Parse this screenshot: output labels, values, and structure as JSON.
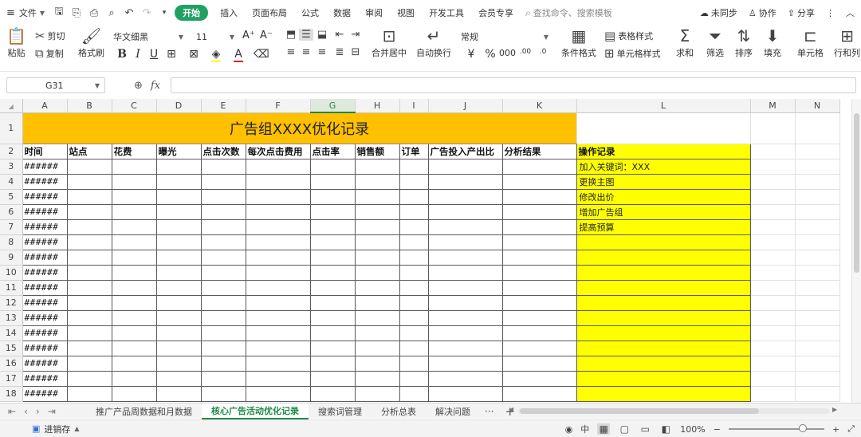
{
  "menubar": {
    "file_label": "文件",
    "items": [
      "开始",
      "插入",
      "页面布局",
      "公式",
      "数据",
      "审阅",
      "视图",
      "开发工具",
      "会员专享"
    ],
    "search_placeholder": "查找命令、搜索模板",
    "right": {
      "sync": "未同步",
      "collab": "协作",
      "share": "分享"
    }
  },
  "ribbon": {
    "paste": "粘贴",
    "cut": "剪切",
    "copy": "复制",
    "format_painter": "格式刷",
    "font_name": "华文细黑",
    "font_size": "11",
    "number_format": "常规",
    "merge_center": "合并居中",
    "wrap_text": "自动换行",
    "conditional_format": "条件格式",
    "table_style": "表格样式",
    "cell_style": "单元格样式",
    "sum": "求和",
    "filter": "筛选",
    "sort": "排序",
    "fill": "填充",
    "cells": "单元格",
    "rows_cols": "行和列"
  },
  "formula_bar": {
    "cell_ref": "G31",
    "fx": "fx",
    "value": ""
  },
  "sheet": {
    "columns": [
      "A",
      "B",
      "C",
      "D",
      "E",
      "F",
      "G",
      "H",
      "I",
      "J",
      "K",
      "L",
      "M",
      "N"
    ],
    "selected_column": "G",
    "title": "广告组XXXX优化记录",
    "headers": [
      "时间",
      "站点",
      "花费",
      "曝光",
      "点击次数",
      "每次点击费用",
      "点击率",
      "销售额",
      "订单",
      "广告投入产出比",
      "分析结果",
      "操作记录"
    ],
    "rows": [
      {
        "num": "3",
        "time": "######",
        "note": "加入关键词：XXX"
      },
      {
        "num": "4",
        "time": "######",
        "note": "更换主图"
      },
      {
        "num": "5",
        "time": "######",
        "note": "修改出价"
      },
      {
        "num": "6",
        "time": "######",
        "note": "增加广告组"
      },
      {
        "num": "7",
        "time": "######",
        "note": "提高预算"
      },
      {
        "num": "8",
        "time": "######",
        "note": ""
      },
      {
        "num": "9",
        "time": "######",
        "note": ""
      },
      {
        "num": "10",
        "time": "######",
        "note": ""
      },
      {
        "num": "11",
        "time": "######",
        "note": ""
      },
      {
        "num": "12",
        "time": "######",
        "note": ""
      },
      {
        "num": "13",
        "time": "######",
        "note": ""
      },
      {
        "num": "14",
        "time": "######",
        "note": ""
      },
      {
        "num": "15",
        "time": "######",
        "note": ""
      },
      {
        "num": "16",
        "time": "######",
        "note": ""
      },
      {
        "num": "17",
        "time": "######",
        "note": ""
      },
      {
        "num": "18",
        "time": "######",
        "note": ""
      }
    ],
    "colors": {
      "title_fill": "#ffc000",
      "note_fill": "#ffff00",
      "accent": "#1e8a4c"
    }
  },
  "tabs": {
    "items": [
      "推广产品周数据和月数据",
      "核心广告活动优化记录",
      "搜索词管理",
      "分析总表",
      "解决问题"
    ],
    "active": "核心广告活动优化记录",
    "more": "···",
    "add": "+"
  },
  "status": {
    "left_label": "进销存",
    "zoom": "100%"
  }
}
